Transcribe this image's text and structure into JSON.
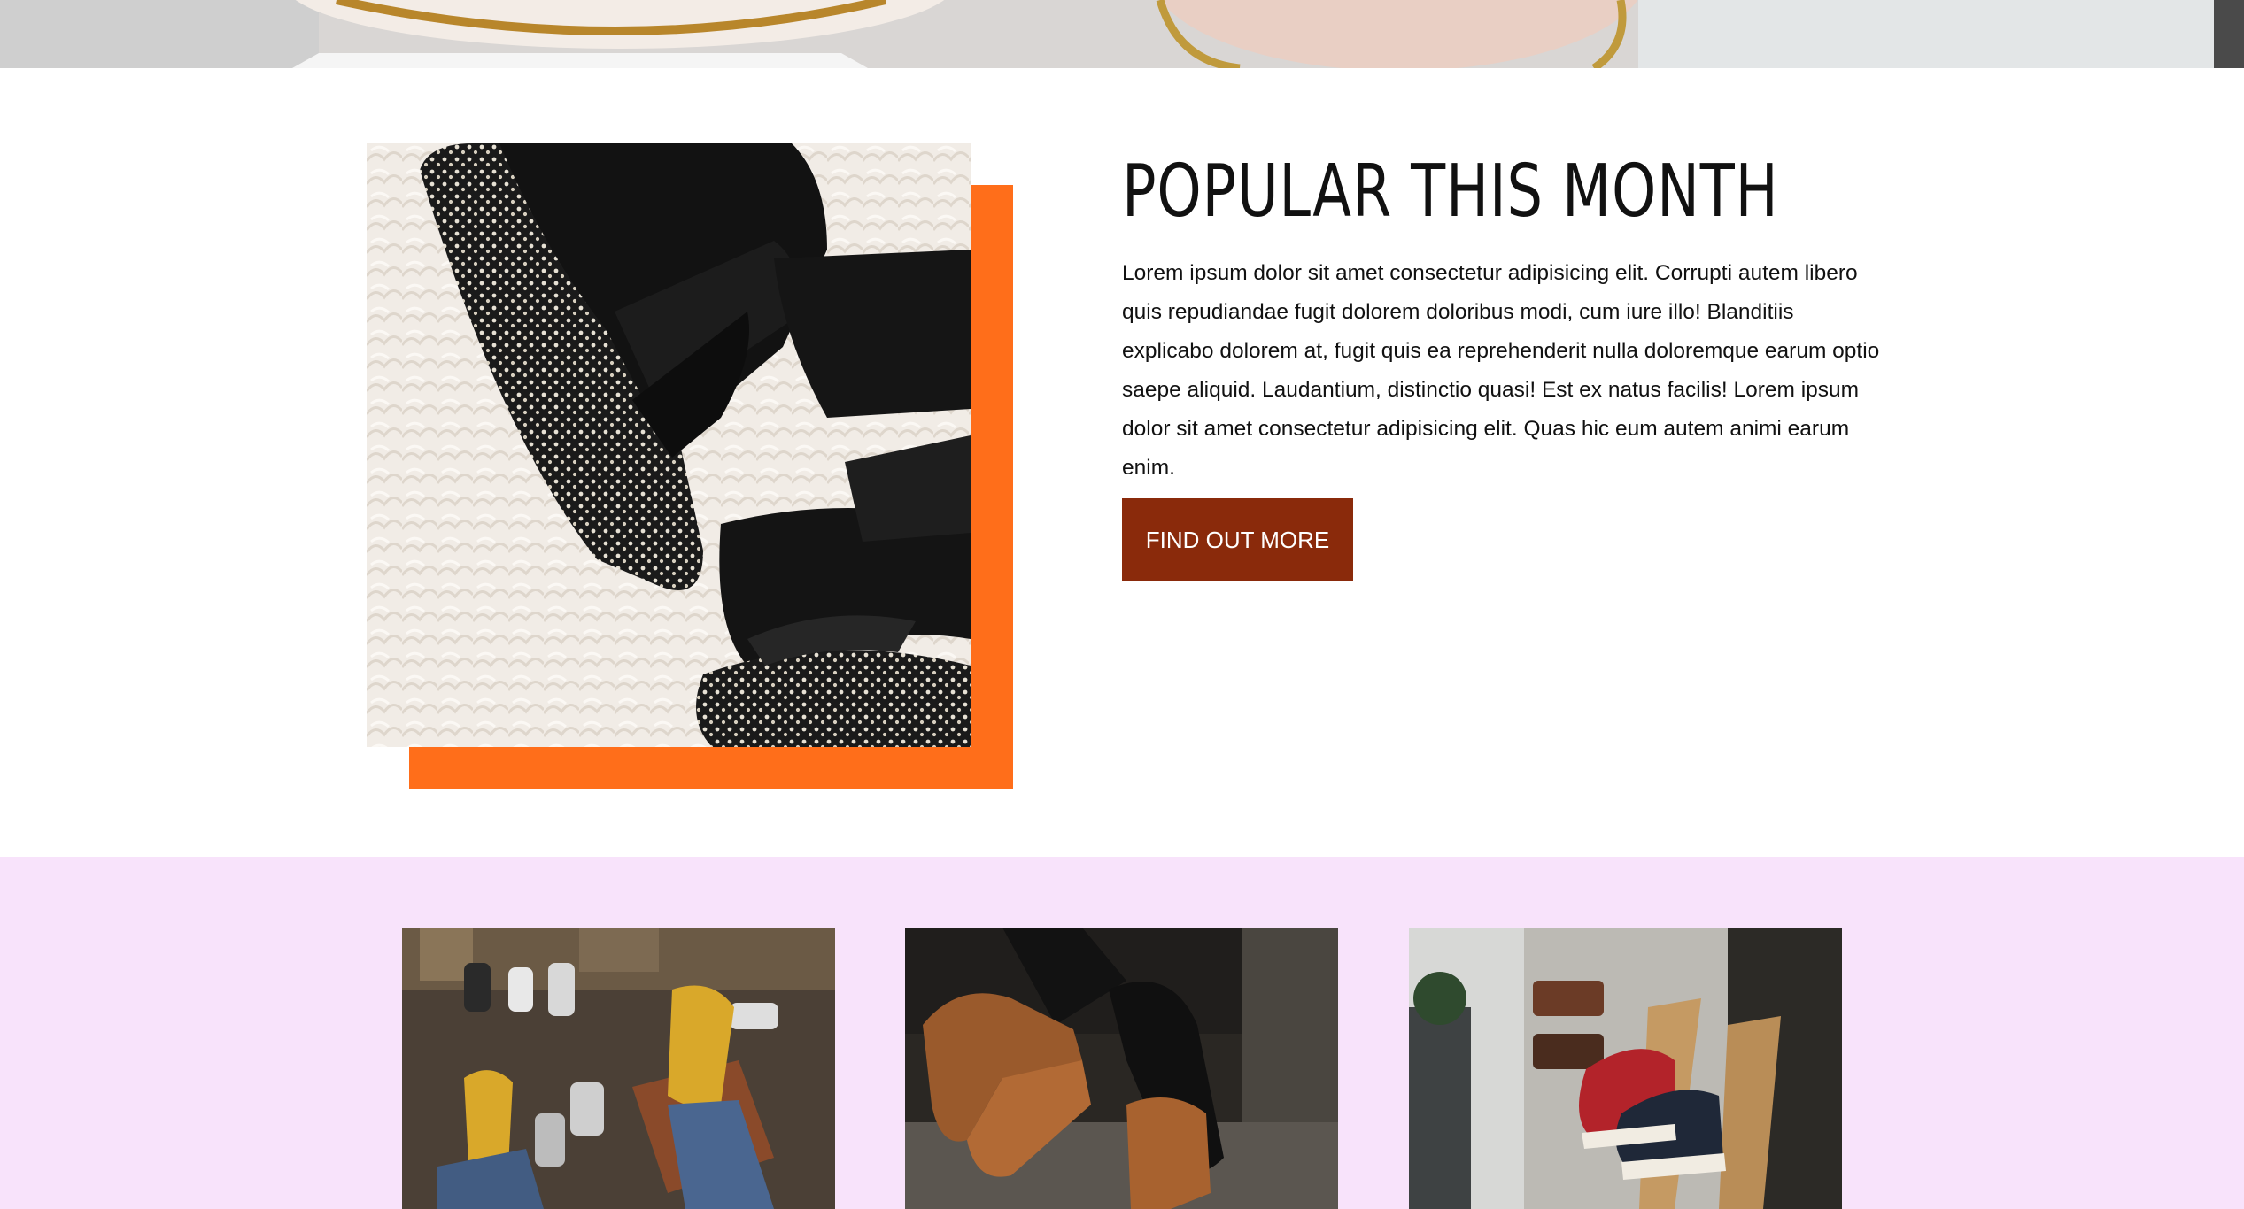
{
  "popular": {
    "title": "POPULAR THIS MONTH",
    "body": "Lorem ipsum dolor sit amet consectetur adipisicing elit. Corrupti autem libero quis repudiandae fugit dolorem doloribus modi, cum iure illo! Blanditiis explicabo dolorem at, fugit quis ea reprehenderit nulla doloremque earum optio saepe aliquid. Laudantium, distinctio quasi! Est ex natus facilis! Lorem ipsum dolor sit amet consectetur adipisicing elit. Quas hic eum autem animi earum enim.",
    "button_label": "FIND OUT MORE"
  },
  "colors": {
    "accent_frame": "#ff6e1a",
    "button_bg": "#8a2a0b",
    "gallery_bg": "#f8e3fb"
  }
}
